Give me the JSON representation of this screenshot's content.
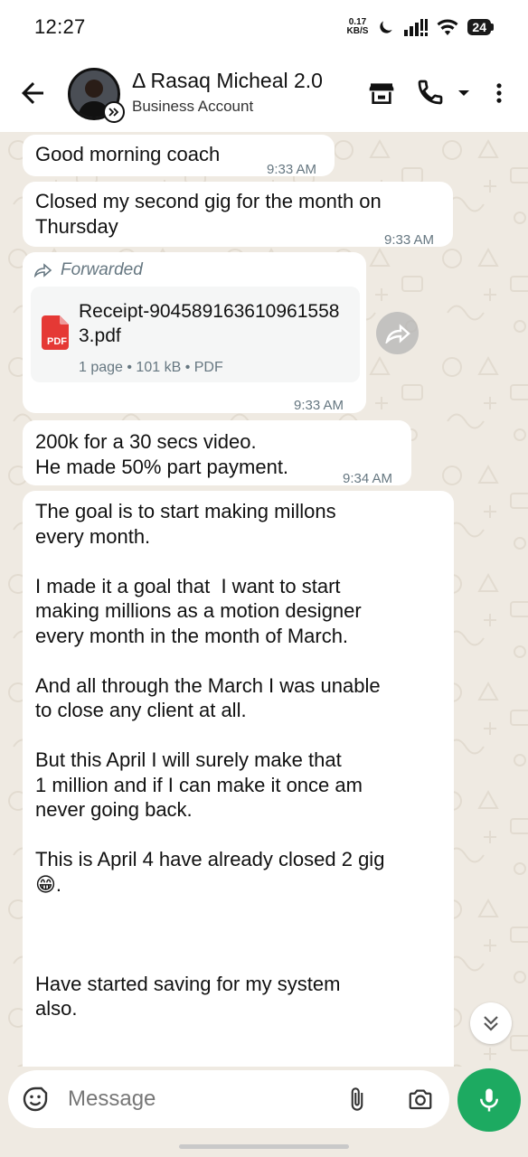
{
  "status_bar": {
    "time": "12:27",
    "net_speed_value": "0.17",
    "net_speed_unit": "KB/S",
    "battery": "24"
  },
  "header": {
    "contact_name": "Δ Rasaq Micheal 2.0",
    "subtitle": "Business Account"
  },
  "messages": [
    {
      "text": "Good morning coach",
      "time": "9:33 AM"
    },
    {
      "text": "Closed my second gig for the month on\nThursday",
      "time": "9:33 AM"
    },
    {
      "forwarded_label": "Forwarded",
      "document": {
        "file_name": "Receipt-9045891636109615583.pdf",
        "meta": "1 page • 101 kB • PDF",
        "icon_label": "PDF"
      },
      "time": "9:33 AM"
    },
    {
      "text": "200k for a 30 secs video.\nHe made 50% part payment.",
      "time": "9:34 AM"
    },
    {
      "text": "The goal is to start making millons\nevery month.\n\nI made it a goal that  I want to start\nmaking millions as a motion designer\nevery month in the month of March.\n\nAnd all through the March I was unable\nto close any client at all.\n\nBut this April I will surely make that\n1 million and if I can make it once am\nnever going back.\n\nThis is April 4 have already closed 2 gig\n😁.\n\n\n\nHave started saving for my system\nalso."
    }
  ],
  "composer": {
    "placeholder": "Message"
  },
  "colors": {
    "chat_background": "#efeae2",
    "bubble": "#ffffff",
    "accent_green": "#1daa61",
    "timestamp": "#667781",
    "pdf_red": "#e53935"
  },
  "icons": [
    "back-arrow-icon",
    "business-badge-icon",
    "catalog-store-icon",
    "phone-icon",
    "chevron-down-icon",
    "more-vert-icon",
    "forward-icon",
    "pdf-file-icon",
    "share-forward-icon",
    "double-chevron-down-icon",
    "emoji-sticker-icon",
    "attach-paperclip-icon",
    "camera-icon",
    "mic-icon",
    "moon-icon",
    "signal-icon",
    "wifi-icon"
  ]
}
